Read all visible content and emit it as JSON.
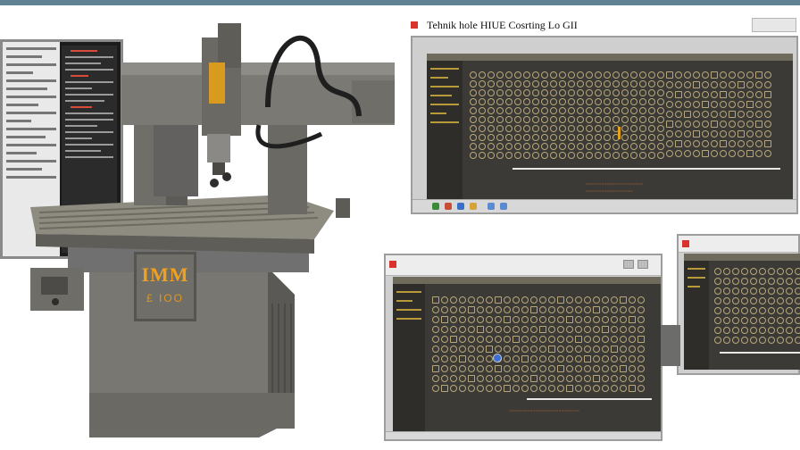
{
  "window_top_right": {
    "title": "Tehnik hole HIUE Cosrting Lo GII"
  },
  "machine": {
    "brand_plate": "IMM",
    "brand_sub": "£ IOO"
  },
  "window_bottom_left": {
    "title": ""
  },
  "window_bottom_right": {
    "title": ""
  },
  "colors": {
    "accent_top_bar": "#5f8194",
    "record_red": "#d9332c",
    "pane_dark": "#3b3a36",
    "grid_tan": "#b8a77a",
    "highlight_yellow": "#e2a21c"
  },
  "icons": [
    "record-icon",
    "window-controls-icon",
    "taskbar-icon",
    "cursor-dot-icon"
  ]
}
